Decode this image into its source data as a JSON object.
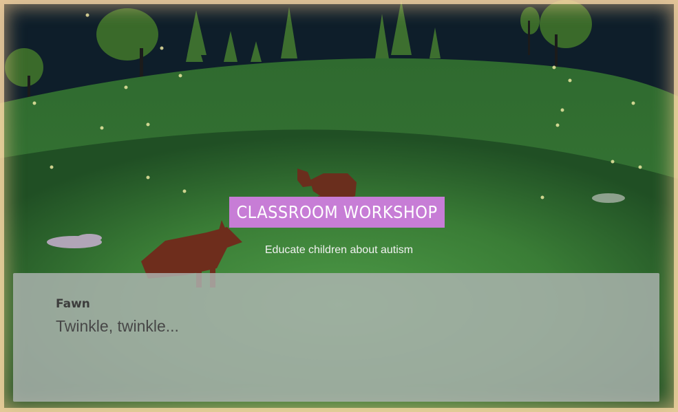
{
  "title_banner": {
    "label": "CLASSROOM WORKSHOP",
    "color": "#c77dd6"
  },
  "subtitle": "Educate children about autism",
  "dialog": {
    "speaker": "Fawn",
    "text": "Twinkle, twinkle..."
  },
  "scene": {
    "description_icons": [
      "fox-icon",
      "deer-icon",
      "flower-icon",
      "tree-icon",
      "firefly-icon"
    ]
  }
}
